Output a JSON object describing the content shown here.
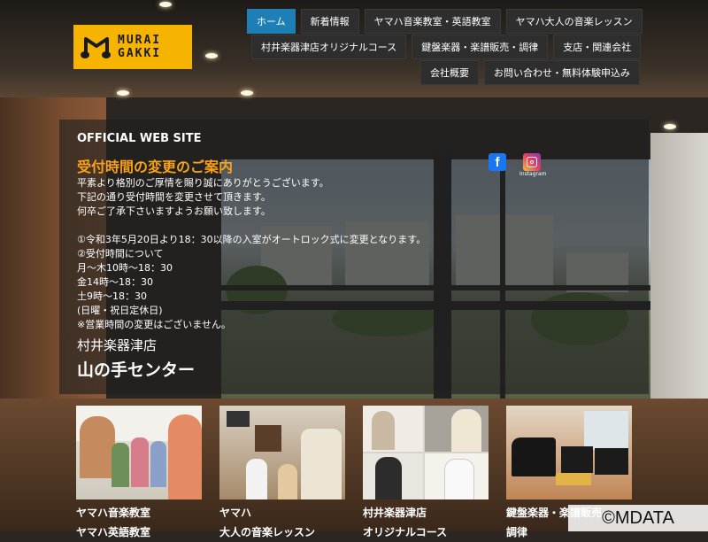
{
  "brand": {
    "logo_line1": "MURAI",
    "logo_line2": "GAKKI",
    "logo_color": "#f6b400"
  },
  "nav": {
    "row1": [
      "ホーム",
      "新着情報",
      "ヤマハ音楽教室・英語教室",
      "ヤマハ大人の音楽レッスン"
    ],
    "row2": [
      "村井楽器津店オリジナルコース",
      "鍵盤楽器・楽譜販売・調律",
      "支店・関連会社"
    ],
    "row3": [
      "会社概要",
      "お問い合わせ・無料体験申込み"
    ],
    "active": "ホーム",
    "active_color": "#1d7fb5"
  },
  "panel": {
    "site_label": "OFFICIAL WEB SITE",
    "notice_title": "受付時間の変更のご案内",
    "notice_lines": [
      "平素より格別のご厚情を賜り誠にありがとうございます。",
      "下記の通り受付時間を変更させて頂きます。",
      "何卒ご了承下さいますようお願い致します。",
      "",
      "①令和3年5月20日より18：30以降の入室がオートロック式に変更となります。",
      "②受付時間について",
      "月～木10時～18：30",
      "金14時～18：30",
      "土9時～18：30",
      "(日曜・祝日定休日)",
      "※営業時間の変更はございません。"
    ],
    "store_name": "村井楽器津店",
    "center_name": "山の手センター",
    "accent_color": "#f7a21b"
  },
  "social": {
    "facebook_icon": "facebook-icon",
    "instagram_icon": "instagram-icon",
    "instagram_label": "Instagram"
  },
  "cards": [
    {
      "line1": "ヤマハ音楽教室",
      "line2": "ヤマハ英語教室"
    },
    {
      "line1": "ヤマハ",
      "line2": "大人の音楽レッスン"
    },
    {
      "line1": "村井楽器津店",
      "line2": "オリジナルコース"
    },
    {
      "line1": "鍵盤楽器・楽譜販売",
      "line2": "調律"
    }
  ],
  "copyright": "©MDATA"
}
